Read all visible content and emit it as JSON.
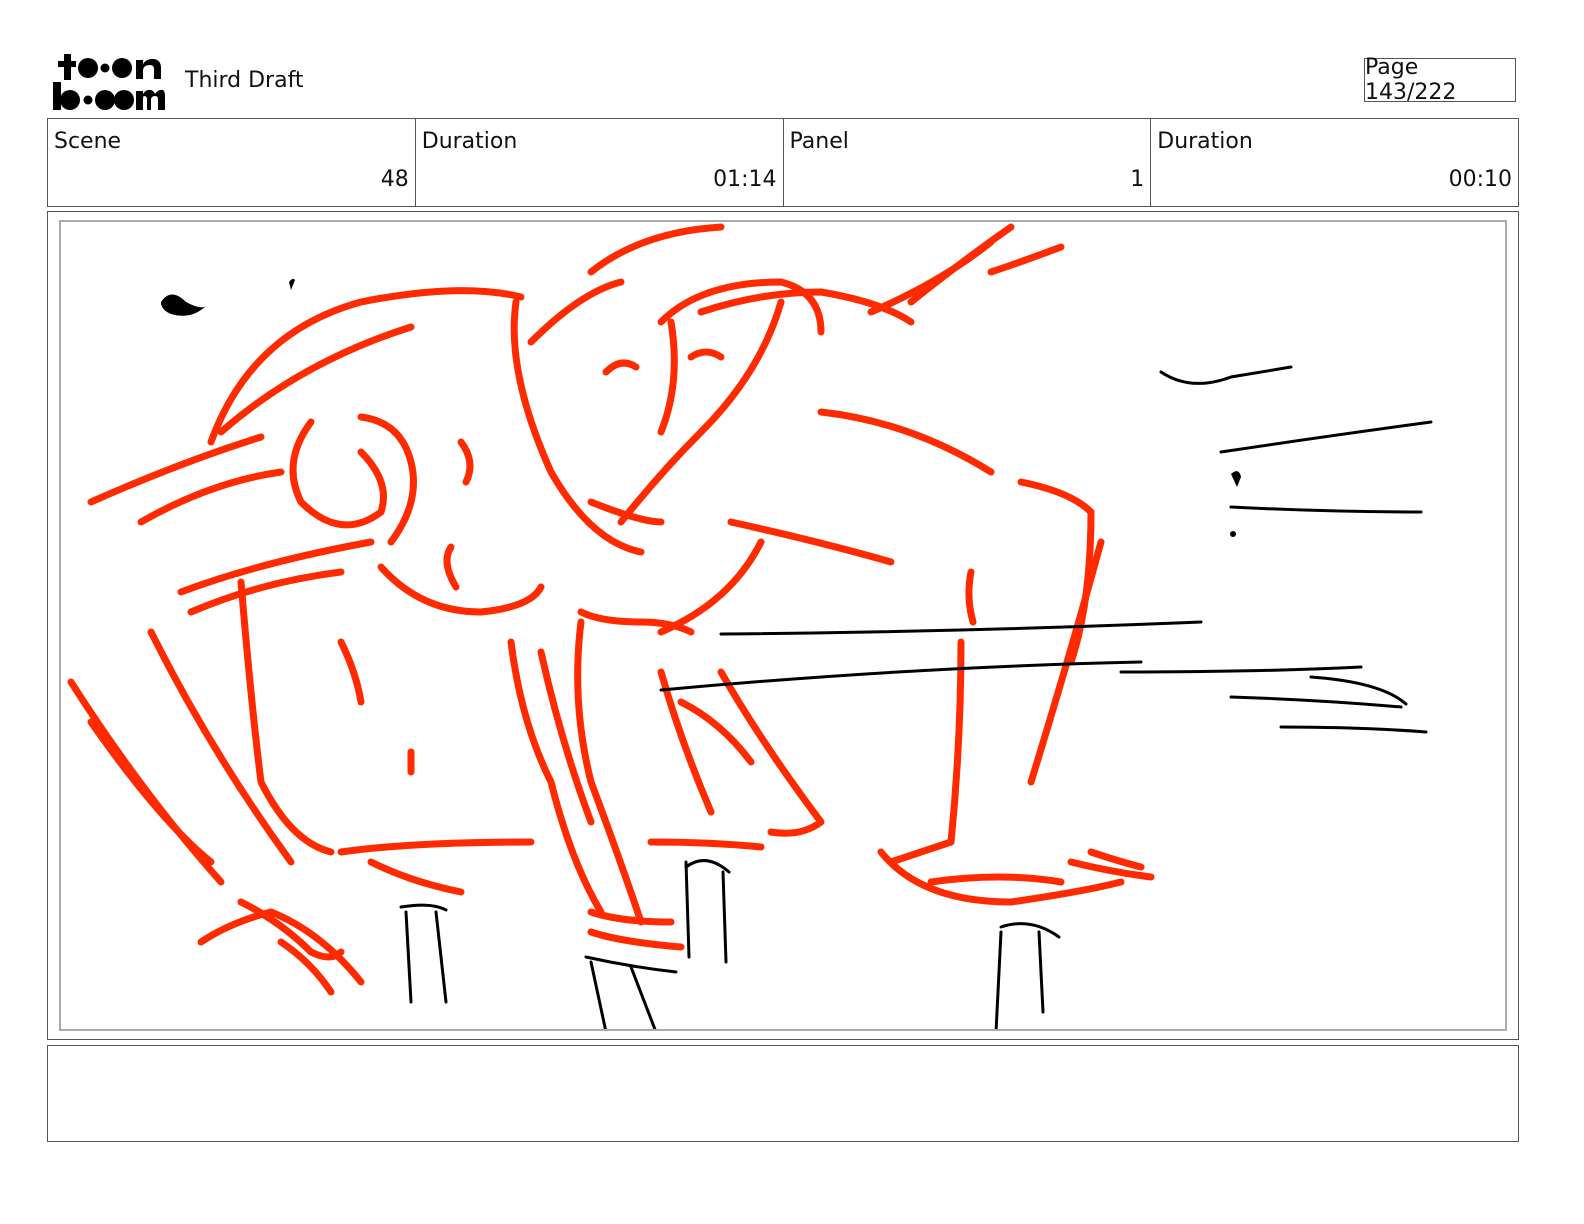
{
  "header": {
    "logo_text": "toon boom",
    "draft_title": "Third Draft",
    "page_label": "Page 143/222"
  },
  "info": {
    "scene_label": "Scene",
    "scene_value": "48",
    "scene_duration_label": "Duration",
    "scene_duration_value": "01:14",
    "panel_label": "Panel",
    "panel_value": "1",
    "panel_duration_label": "Duration",
    "panel_duration_value": "00:10"
  },
  "colors": {
    "sketch_red": "#ff2a00",
    "sketch_black": "#000000"
  },
  "notes": {
    "text": ""
  }
}
